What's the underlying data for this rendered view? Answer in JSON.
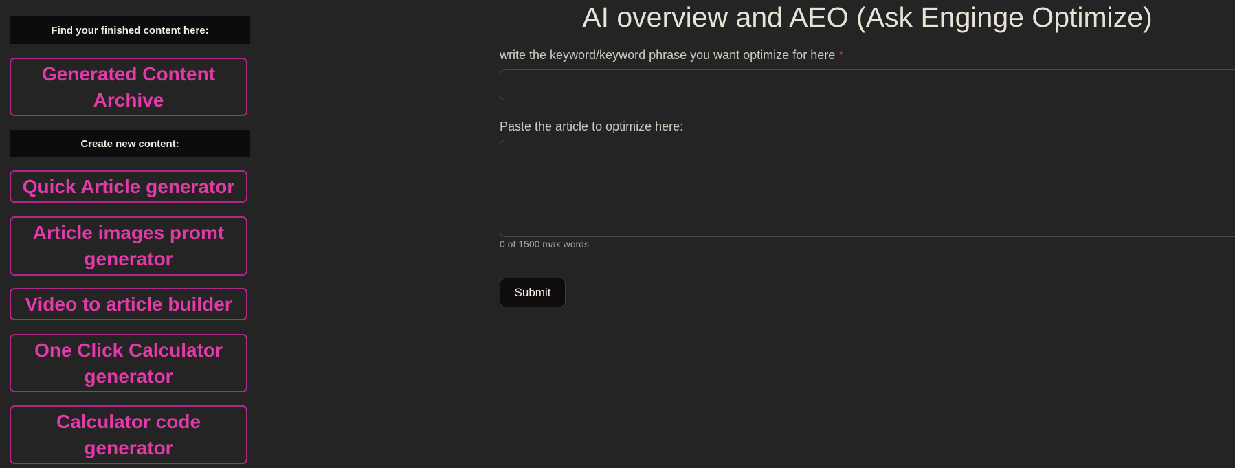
{
  "sidebar": {
    "finished_header": "Find your finished content here:",
    "archive_button": "Generated Content Archive",
    "create_header": "Create new content:",
    "items": [
      {
        "label": "Quick Article generator"
      },
      {
        "label": "Article images promt generator"
      },
      {
        "label": "Video to article builder"
      },
      {
        "label": "One Click Calculator generator"
      },
      {
        "label": "Calculator code generator"
      }
    ]
  },
  "main": {
    "title": "AI overview and AEO (Ask Enginge Optimize)",
    "keyword_label": "write the keyword/keyword phrase you want optimize for here",
    "required_mark": "*",
    "keyword_value": "",
    "article_label": "Paste the article to optimize here:",
    "article_value": "",
    "word_count": "0 of 1500 max words",
    "submit_label": "Submit"
  },
  "colors": {
    "accent": "#e33aa9",
    "border": "#b3278a",
    "background": "#232423"
  }
}
